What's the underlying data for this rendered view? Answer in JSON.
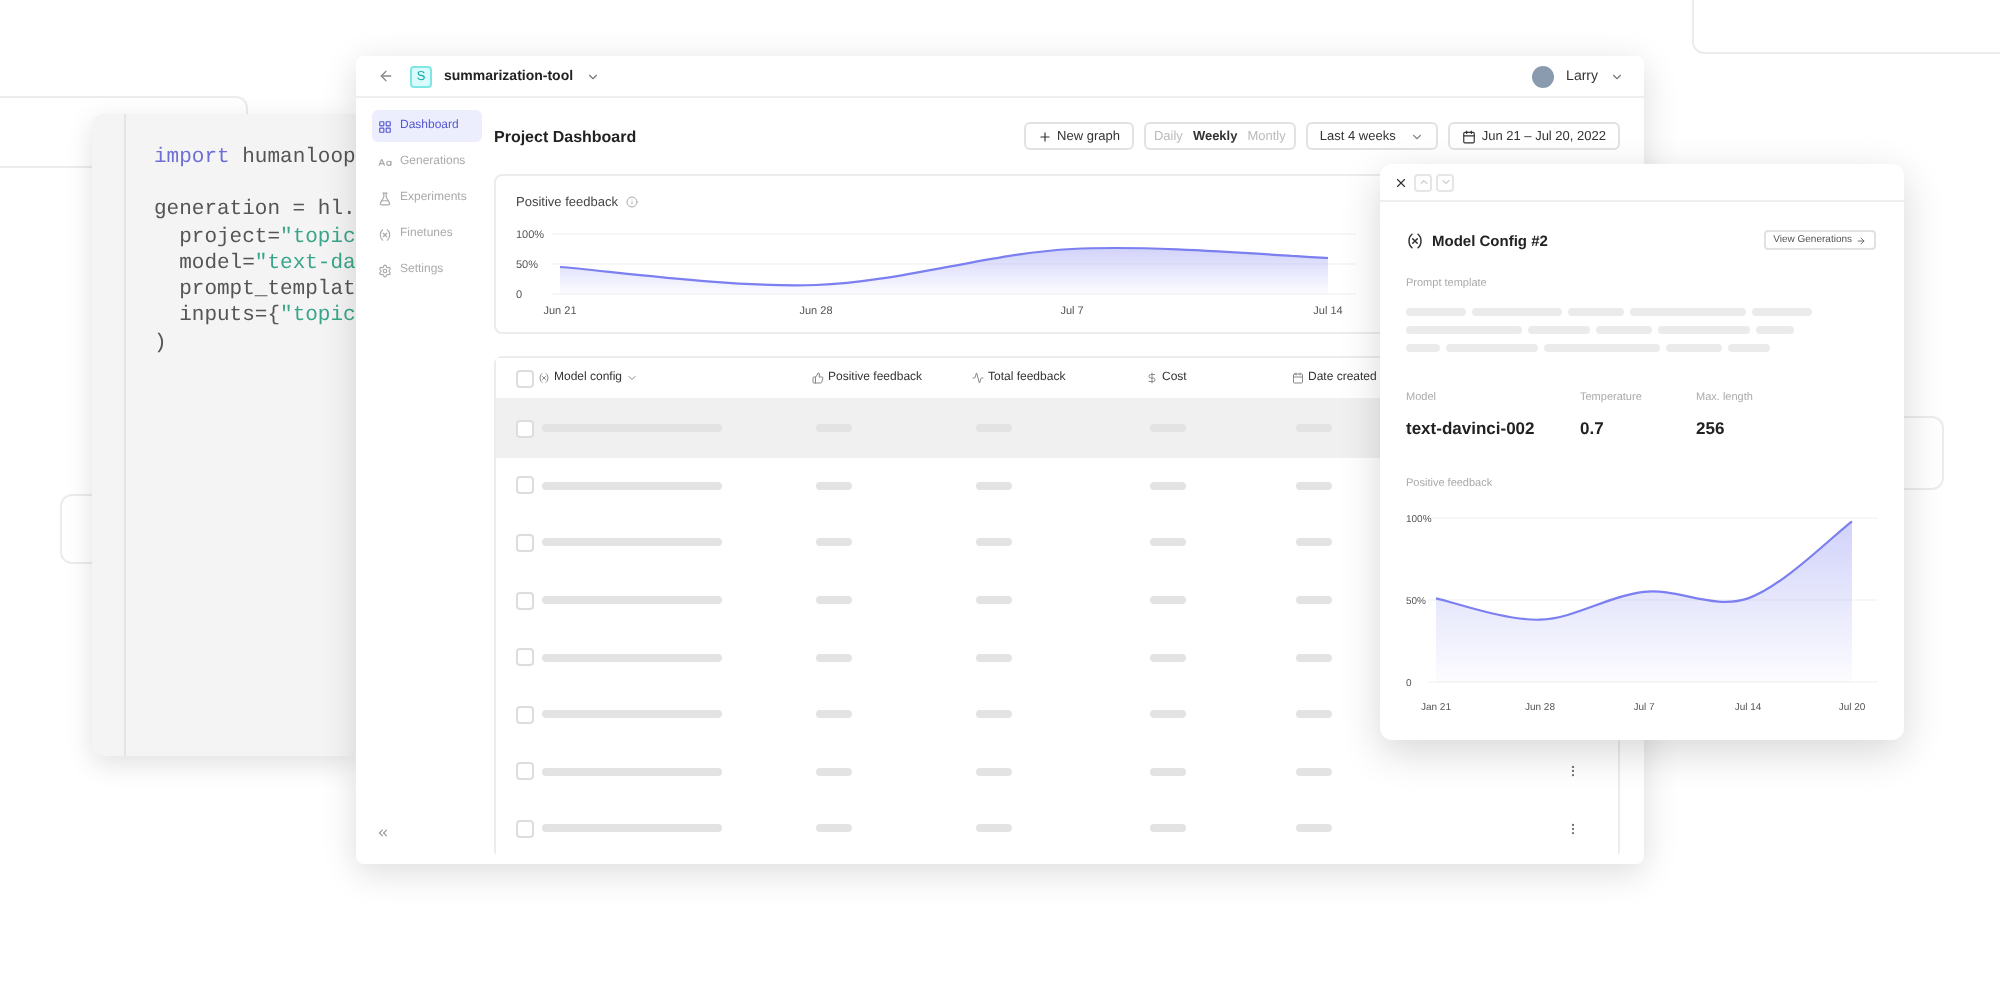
{
  "code_window": {
    "blocks": [
      {
        "lines": [
          {
            "tokens": [
              {
                "kind": "keyword",
                "text": "import"
              },
              {
                "kind": "plain",
                "text": " humanloop"
              }
            ]
          }
        ]
      },
      {
        "lines": [
          {
            "tokens": [
              {
                "kind": "plain",
                "text": "generation = hl."
              }
            ]
          },
          {
            "tokens": [
              {
                "kind": "plain",
                "text": "  project="
              },
              {
                "kind": "string",
                "text": "\"topic"
              }
            ]
          },
          {
            "tokens": [
              {
                "kind": "plain",
                "text": "  model="
              },
              {
                "kind": "string",
                "text": "\"text-da"
              }
            ]
          },
          {
            "tokens": [
              {
                "kind": "plain",
                "text": "  prompt_templat"
              }
            ]
          },
          {
            "tokens": [
              {
                "kind": "plain",
                "text": "  inputs={"
              },
              {
                "kind": "string",
                "text": "\"topic"
              }
            ]
          },
          {
            "tokens": [
              {
                "kind": "plain",
                "text": ")"
              }
            ]
          }
        ]
      }
    ]
  },
  "dashboard": {
    "project": {
      "badge": "S",
      "name": "summarization-tool"
    },
    "user": {
      "name": "Larry"
    },
    "sidebar": {
      "items": [
        {
          "label": "Dashboard",
          "selected": true
        },
        {
          "label": "Generations",
          "selected": false
        },
        {
          "label": "Experiments",
          "selected": false
        },
        {
          "label": "Finetunes",
          "selected": false
        },
        {
          "label": "Settings",
          "selected": false
        }
      ]
    },
    "title": "Project Dashboard",
    "toolbar": {
      "new_graph": "New graph",
      "intervals": [
        {
          "label": "Daily",
          "selected": false
        },
        {
          "label": "Weekly",
          "selected": true
        },
        {
          "label": "Montly",
          "selected": false
        }
      ],
      "range": "Last 4 weeks",
      "dates": "Jun 21 – Jul 20, 2022"
    },
    "feedback_card": {
      "title": "Positive feedback",
      "chart_data": {
        "type": "area",
        "categories": [
          "Jun 21",
          "Jun 28",
          "Jul 7",
          "Jul 14"
        ],
        "series": [
          {
            "color": "#7b7ff0",
            "values": [
              45,
              15,
              75,
              60
            ]
          }
        ],
        "ylim": [
          0,
          100
        ],
        "yticks": [
          0,
          {
            "value": 50,
            "label": "50%"
          },
          {
            "value": 100,
            "label": "100%"
          }
        ]
      }
    },
    "table": {
      "all_checked": false,
      "columns": [
        "Model config",
        "Positive feedback",
        "Total feedback",
        "Cost",
        "Date created"
      ],
      "rows": [
        {
          "selected": true,
          "checked": false,
          "menu": false
        },
        {
          "selected": false,
          "checked": false,
          "menu": false
        },
        {
          "selected": false,
          "checked": false,
          "menu": false
        },
        {
          "selected": false,
          "checked": false,
          "menu": false
        },
        {
          "selected": false,
          "checked": false,
          "menu": false
        },
        {
          "selected": false,
          "checked": false,
          "menu": false
        },
        {
          "selected": false,
          "checked": false,
          "menu": true
        },
        {
          "selected": false,
          "checked": false,
          "menu": true
        }
      ]
    }
  },
  "detail_panel": {
    "title": "Model Config #2",
    "view_button": "View Generations",
    "prompt_label": "Prompt template",
    "fields": [
      {
        "label": "Model",
        "value": "text-davinci-002"
      },
      {
        "label": "Temperature",
        "value": "0.7"
      },
      {
        "label": "Max. length",
        "value": "256"
      }
    ],
    "chart_title": "Positive feedback",
    "chart_data": {
      "type": "area",
      "categories": [
        "Jan 21",
        "Jun 28",
        "Jul 7",
        "Jul 14",
        "Jul 20"
      ],
      "series": [
        {
          "color": "#7b7ff0",
          "values": [
            51,
            38,
            55,
            51,
            98
          ]
        }
      ],
      "ylim": [
        0,
        100
      ],
      "yticks": [
        0,
        {
          "value": 50,
          "label": "50%"
        },
        {
          "value": 100,
          "label": "100%"
        }
      ]
    }
  }
}
